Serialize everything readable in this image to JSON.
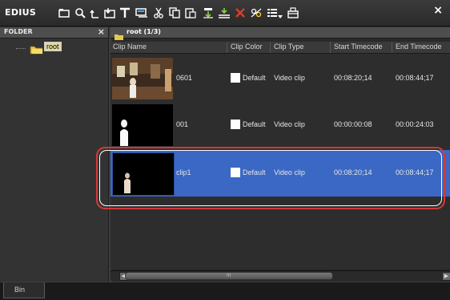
{
  "app": {
    "logo_text": "EDIUS"
  },
  "toolbar": {
    "buttons": [
      "new-bin-icon",
      "search-icon",
      "up-folder-icon",
      "open-icon",
      "title-icon",
      "add-sequence-icon",
      "cut-icon",
      "copy-icon",
      "paste-icon",
      "add-to-timeline-icon",
      "insert-icon",
      "delete-icon",
      "properties-icon",
      "view-mode-icon",
      "bin-menu-icon"
    ],
    "close_symbol": "×"
  },
  "folder_panel": {
    "header": "FOLDER",
    "close_symbol": "×",
    "tree": [
      {
        "label": "root"
      }
    ]
  },
  "clip_panel": {
    "path_label": "root (1/3)",
    "columns": [
      "Clip Name",
      "Clip Color",
      "Clip Type",
      "Start Timecode",
      "End Timecode"
    ],
    "rows": [
      {
        "name": "0601",
        "clip_color": "Default",
        "clip_type": "Video clip",
        "start": "00:08:20;14",
        "end": "00:08:44;17",
        "selected": false
      },
      {
        "name": "001",
        "clip_color": "Default",
        "clip_type": "Video clip",
        "start": "00:00:00:08",
        "end": "00:00:24:03",
        "selected": false
      },
      {
        "name": "clip1",
        "clip_color": "Default",
        "clip_type": "Video clip",
        "start": "00:08:20;14",
        "end": "00:08:44;17",
        "selected": true
      }
    ],
    "scrollbar_grip": "III"
  },
  "bottom_tabs": [
    {
      "label": "Bin"
    }
  ],
  "colors": {
    "selection": "#3a68c4",
    "highlight": "#d03a3a"
  }
}
